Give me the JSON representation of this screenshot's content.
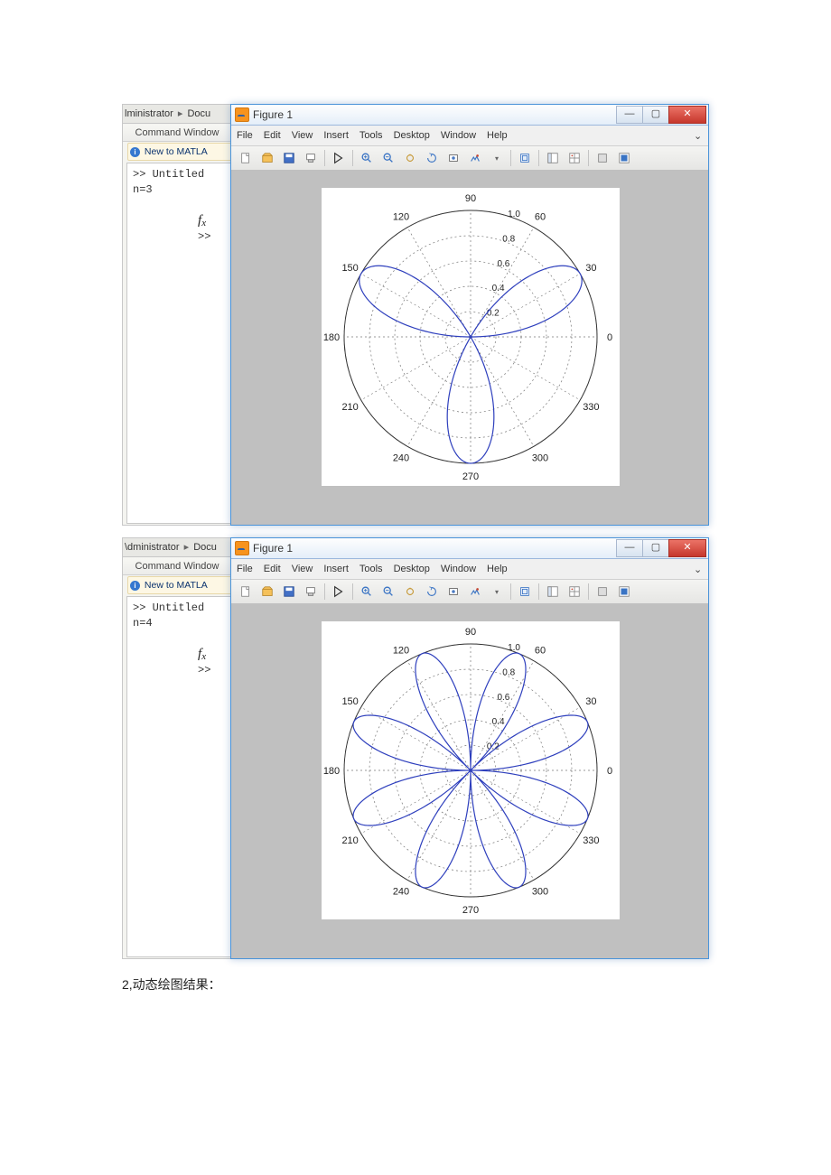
{
  "panes": [
    {
      "breadcrumb_left": "lministrator",
      "breadcrumb_right": "Docu",
      "cmd_title": "Command Window",
      "new_to": "New to MATLA",
      "line1": ">> Untitled",
      "line2": "n=3",
      "prompt": ">>",
      "fig_title": "Figure 1",
      "chart": {
        "n": 3,
        "k": 3
      }
    },
    {
      "breadcrumb_left": "\\dministrator",
      "breadcrumb_right": "Docu",
      "cmd_title": "Command Window",
      "new_to": "New to MATLA",
      "line1": ">> Untitled",
      "line2": "n=4",
      "prompt": ">>",
      "fig_title": "Figure 1",
      "chart": {
        "n": 4,
        "k": 4
      }
    }
  ],
  "menus": [
    "File",
    "Edit",
    "View",
    "Insert",
    "Tools",
    "Desktop",
    "Window",
    "Help"
  ],
  "winbtns": {
    "min": "—",
    "max": "▢",
    "close": "✕"
  },
  "chart_data": [
    {
      "type": "polar",
      "title": "",
      "function": "r = sin(3θ)",
      "angle_ticks": [
        0,
        30,
        60,
        90,
        120,
        150,
        180,
        210,
        240,
        270,
        300,
        330
      ],
      "radial_ticks": [
        0.2,
        0.4,
        0.6,
        0.8,
        1
      ],
      "r_max": 1
    },
    {
      "type": "polar",
      "title": "",
      "function": "r = sin(4θ)",
      "angle_ticks": [
        0,
        30,
        60,
        90,
        120,
        150,
        180,
        210,
        240,
        270,
        300,
        330
      ],
      "radial_ticks": [
        0.2,
        0.4,
        0.6,
        0.8,
        1
      ],
      "r_max": 1
    }
  ],
  "caption": "2,动态绘图结果："
}
